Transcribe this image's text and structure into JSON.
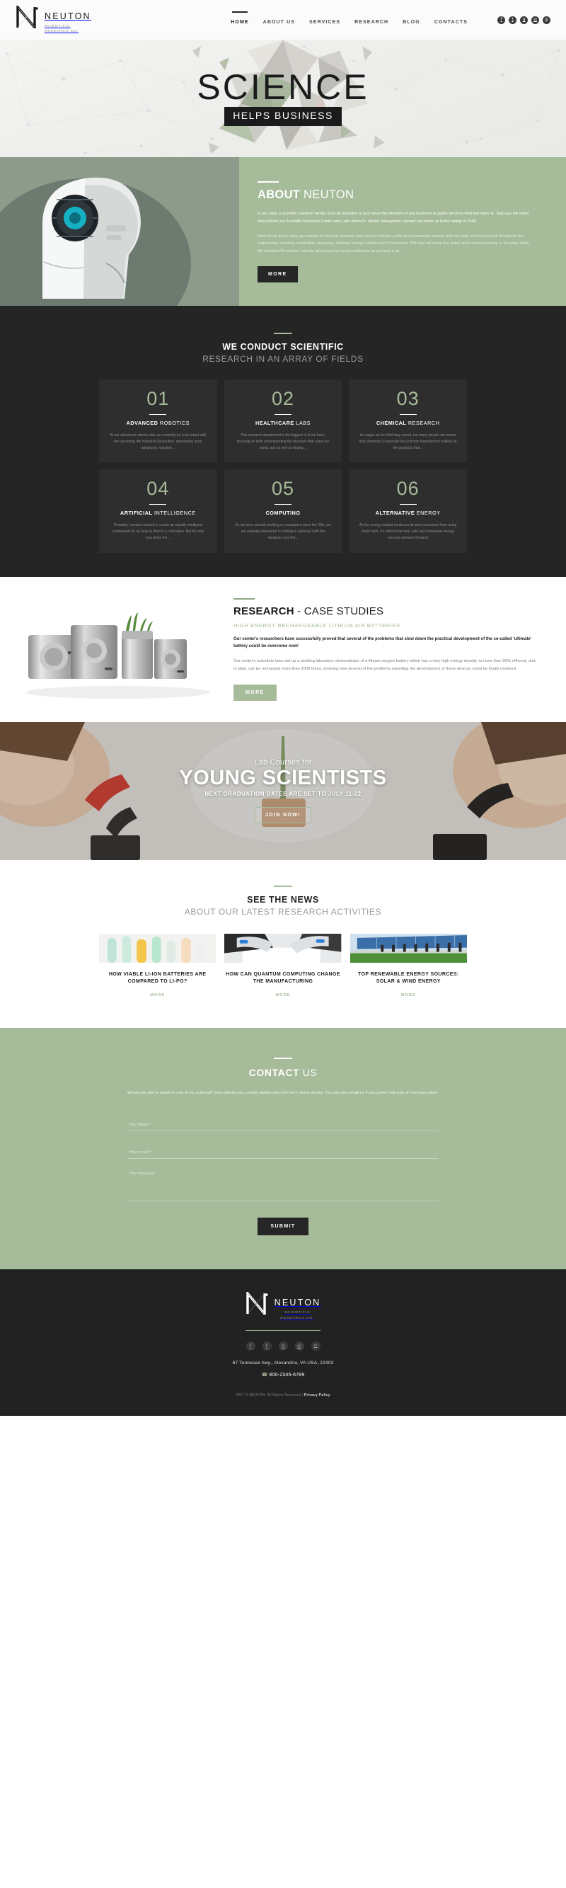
{
  "brand": {
    "name": "NEUTON",
    "sub_line1": "SCIENTIFIC",
    "sub_line2": "RESEARCH CO."
  },
  "header": {
    "nav": [
      {
        "label": "HOME",
        "active": true
      },
      {
        "label": "ABOUT US",
        "active": false
      },
      {
        "label": "SERVICES",
        "active": false
      },
      {
        "label": "RESEARCH",
        "active": false
      },
      {
        "label": "BLOG",
        "active": false
      },
      {
        "label": "CONTACTS",
        "active": false
      }
    ],
    "social": [
      {
        "name": "facebook-icon",
        "glyph": "f"
      },
      {
        "name": "twitter-icon",
        "glyph": "t"
      },
      {
        "name": "google-plus-icon",
        "glyph": "g"
      },
      {
        "name": "instagram-icon",
        "glyph": "◎"
      },
      {
        "name": "linkedin-icon",
        "glyph": "in"
      }
    ]
  },
  "hero": {
    "title": "SCIENCE",
    "subtitle": "HELPS BUSINESS"
  },
  "about": {
    "heading_bold": "ABOUT",
    "heading_light": " NEUTON",
    "paragraph1": "In our view, a scientific research facility must be available to and serve the interests of any business or public services field that there is. That was the initial idea behind our Scientific Research Center and Labs when Dr. Martin Strangelove opened our doors up in the spring of 1946.",
    "paragraph2": "Since those times many generations of talented scientists have served both the public and commercial interest, with our mark of innovation left throughout the engineering, chemical, medication, weaponry, alternate energy, robotics and IT industries. With that still being true today, we're working closely, in the wake of the 4th Industrial Revolution, towards advancing the human civilization as we know it an...",
    "button": "MORE"
  },
  "fields": {
    "title_top": "WE CONDUCT SCIENTIFIC",
    "title_bottom": "RESEARCH IN AN ARRAY OF FIELDS",
    "cards": [
      {
        "number": "01",
        "title_bold": "ADVANCED",
        "title_light": " ROBOTICS",
        "text": "At our advanced robotics lab, we currently try to be intact with the upcoming 4th Industrial Revolution, developing more advanced, machine..."
      },
      {
        "number": "02",
        "title_bold": "HEALTHCARE",
        "title_light": " LABS",
        "text": "This research department is the biggest of al we have, focusing on both understanding the diseases that roam our world, just as well as finding..."
      },
      {
        "number": "03",
        "title_bold": "CHEMICAL",
        "title_light": " RESEARCH",
        "text": "As vague as the field may sound, not many people are aware that chemistry is basically the lynchpin ingredient of making all the products that..."
      },
      {
        "number": "04",
        "title_bold": "ARTIFICIAL",
        "title_light": " INTELLIGENCE",
        "text": "Probably, humans wanted to create an equally intelligent counterpart for as long as there's a civilization. But it's only now when the..."
      },
      {
        "number": "05",
        "title_bold": "COMPUTING",
        "title_light": "",
        "text": "As we were already working on computers since the '50s, we are naturally interested in helping to advance both the hardware and the..."
      },
      {
        "number": "06",
        "title_bold": "ALTERNATIVE",
        "title_light": " ENERGY",
        "text": "As the energy market continues its slow movement from using fossil fuels, it's critical that new, safe and renewable energy sources advance forward!"
      }
    ]
  },
  "research": {
    "heading_bold": "RESEARCH",
    "heading_light": " - CASE STUDIES",
    "subheading": "HIGH ENERGY RECHARGEABLE LITHIUM AIR BATTERIES",
    "lead": "Our center's researchers have successfully proved that several of the problems that slow down the practical development of the so-called 'ultimate' battery could be overcome now!",
    "paragraph": "Our center's scientists have set up a working laboratory demonstrator of a lithium-oxygen battery which has a very high energy density, is more than 90% efficient, and, to date, can be recharged more than 2000 times, showing how several of the problems impeding the development of these devices could be finally resolved.",
    "button": "MORE"
  },
  "young": {
    "pre_title": "Lab Courses for",
    "title": "YOUNG SCIENTISTS",
    "subtitle": "NEXT GRADUATION DATES ARE SET TO JULY 11-22",
    "button": "JOIN NOW!"
  },
  "news": {
    "title_top": "SEE THE NEWS",
    "title_bottom": "ABOUT OUR LATEST RESEARCH ACTIVITIES",
    "items": [
      {
        "title": "HOW VIABLE LI-ION BATTERIES ARE COMPARED TO LI-PO?",
        "more": "MORE",
        "thumb": "test-tubes-photo"
      },
      {
        "title": "HOW CAN QUANTUM COMPUTING CHANGE THE MANUFACTURING",
        "more": "MORE",
        "thumb": "gloved-hands-tablet-photo"
      },
      {
        "title": "TOP RENEWABLE ENERGY SOURCES: SOLAR & WIND ENERGY",
        "more": "MORE",
        "thumb": "solar-panels-photo"
      }
    ]
  },
  "contact": {
    "heading_bold": "CONTACT",
    "heading_light": " US",
    "lead": "Would you like to speak to one of our scientist? Just submit your contact details and we'll be in touch shortly. You can also email us if you prefer that type of communication.",
    "fields": {
      "name_placeholder": "Your Name *",
      "name_value": "",
      "email_placeholder": "Your e-mail *",
      "email_value": "",
      "message_placeholder": "Your message *",
      "message_value": ""
    },
    "submit": "SUBMIT"
  },
  "footer": {
    "social": [
      {
        "name": "facebook-icon",
        "glyph": "f"
      },
      {
        "name": "twitter-icon",
        "glyph": "t"
      },
      {
        "name": "google-plus-icon",
        "glyph": "g"
      },
      {
        "name": "instagram-icon",
        "glyph": "◎"
      },
      {
        "name": "linkedin-icon",
        "glyph": "in"
      }
    ],
    "address": "87 Tennesee hwy., Alexandria, VA USA, 22303",
    "phone": "800-2345-6789",
    "copyright": "2017 © NEUTON. All Rights Reserved  |  ",
    "privacy": "Privacy Policy"
  },
  "colors": {
    "accent_green": "#a6bb9a",
    "dark": "#252525",
    "footer_dark": "#222222"
  }
}
